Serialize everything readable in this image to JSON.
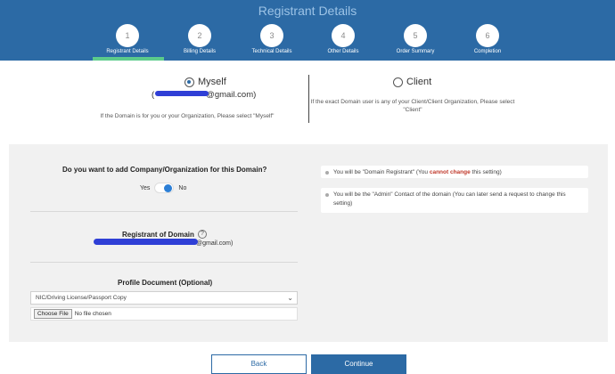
{
  "header": {
    "title": "Registrant Details",
    "steps": [
      {
        "number": "1",
        "label": "Registrant Details"
      },
      {
        "number": "2",
        "label": "Billing Details"
      },
      {
        "number": "3",
        "label": "Technical Details"
      },
      {
        "number": "4",
        "label": "Other Details"
      },
      {
        "number": "5",
        "label": "Order Summary"
      },
      {
        "number": "6",
        "label": "Completion"
      }
    ],
    "active_step": 1
  },
  "owner_choice": {
    "myself_label": "Myself",
    "myself_email_open": "(",
    "myself_email_suffix": "@gmail.com)",
    "myself_hint": "If the Domain is for you or your Organization, Please select \"Myself\"",
    "client_label": "Client",
    "client_hint": "If the exact Domain user is any of your Client/Client Organization, Please select \"Client\"",
    "selected": "Myself"
  },
  "company": {
    "question": "Do you want to add Company/Organization for this Domain?",
    "yes_label": "Yes",
    "no_label": "No",
    "selected": "No"
  },
  "info": {
    "registrant_prefix": "You will be \"Domain Registrant\" (You",
    "registrant_warn": "cannot change",
    "registrant_suffix": "this setting)",
    "admin_text": "You will be the \"Admin\" Contact of the domain (You can later send a request to change this setting)"
  },
  "registrant": {
    "label": "Registrant of Domain",
    "help_icon": "?",
    "email_suffix": "@gmail.com)"
  },
  "profile": {
    "label": "Profile Document (Optional)",
    "select_value": "NIC/Driving License/Passport Copy",
    "file_button": "Choose File",
    "file_status": "No file chosen"
  },
  "buttons": {
    "back": "Back",
    "continue": "Continue"
  },
  "colors": {
    "header_bg": "#2c6aa5",
    "active_underline": "#5ccb8b",
    "warn": "#c0392b"
  }
}
